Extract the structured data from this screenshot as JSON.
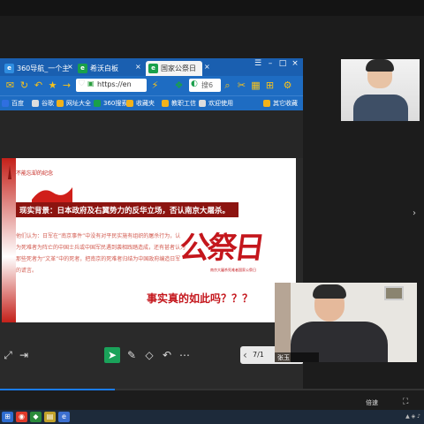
{
  "browser": {
    "tabs": [
      {
        "label": "360导航_一个主",
        "icon": "e",
        "color": "#2f8de0",
        "active": false
      },
      {
        "label": "希沃白板",
        "icon": "e",
        "color": "#19a04b",
        "active": false
      },
      {
        "label": "国家公祭日",
        "icon": "e",
        "color": "#19a04b",
        "active": true
      }
    ],
    "address": "https://en",
    "search_placeholder": "搜6",
    "bookmarks": [
      "百度",
      "谷歌",
      "网址大全",
      "360搜索",
      "收藏夹",
      "教职工信",
      "欢迎使用",
      "其它收藏"
    ]
  },
  "slide": {
    "remember_label": "不能忘却的纪念",
    "headline": "现实背景：日本政府及右翼势力的反华立场，否认南京大屠杀。",
    "body_text": "他们认为：日军在“南京事件”中没有对平民实施有组织的屠杀行为，认为死难者为阵亡的中国士兵或中国军民遇到袭相践踏造成，还有甚者认为那些死者为“文革”中的死者，把南京的死难者归结为中国政府编造日军的谎言。",
    "calligraphy": "公祭日",
    "calligraphy_sub": "南京大屠杀死难者国家公祭日",
    "question": "事实真的如此吗？？？"
  },
  "toolbar": {
    "page_indicator": "7/1"
  },
  "participants": {
    "camera2_name": "张玉"
  },
  "player": {
    "progress": 0.27,
    "speed_label": "倍速"
  }
}
